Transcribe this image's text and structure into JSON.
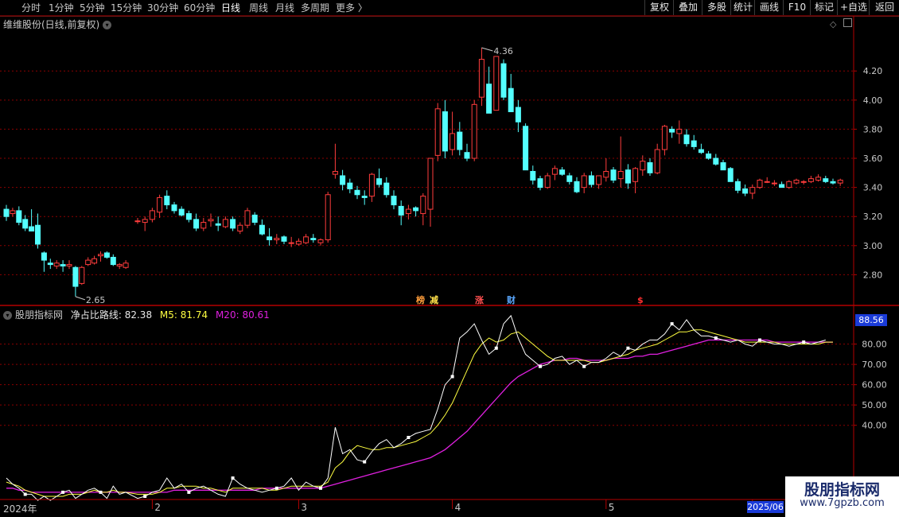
{
  "toolbar": {
    "timeframes": [
      "分时",
      "1分钟",
      "5分钟",
      "15分钟",
      "30分钟",
      "60分钟",
      "日线",
      "周线",
      "月线",
      "多周期",
      "更多"
    ],
    "active": "日线",
    "more_arrow": "〉",
    "right_buttons": [
      "复权",
      "叠加",
      "多股",
      "统计",
      "画线",
      "F10",
      "标记",
      "+自选",
      "返回"
    ]
  },
  "stock": {
    "title": "维维股份(日线,前复权)",
    "high_label": "4.36",
    "low_label": "2.65",
    "y_ticks": [
      "4.20",
      "4.00",
      "3.80",
      "3.60",
      "3.40",
      "3.20",
      "3.00",
      "2.80"
    ],
    "marks": [
      {
        "text": "榜",
        "color": "#ff9d3a"
      },
      {
        "text": "减",
        "color": "#ffe04a"
      },
      {
        "text": "涨",
        "color": "#ff5050"
      },
      {
        "text": "财",
        "color": "#5aa8ff"
      },
      {
        "text": "$",
        "color": "#ff3030"
      }
    ]
  },
  "indicator": {
    "name": "股朋指标网",
    "line_label": "净占比路线:",
    "line_value": "82.38",
    "m5_label": "M5:",
    "m5_value": "81.74",
    "m20_label": "M20:",
    "m20_value": "80.61",
    "current_value": "88.56",
    "y_ticks": [
      "80.00",
      "70.00",
      "60.00",
      "50.00",
      "40.00"
    ],
    "colors": {
      "main": "#ffffff",
      "m5": "#ffff40",
      "m20": "#e020e0"
    }
  },
  "x_axis": {
    "labels": [
      "2024年",
      "2",
      "3",
      "4",
      "5",
      "6"
    ],
    "end_label": "2025/06"
  },
  "watermark": {
    "title": "股朋指标网",
    "url": "www.7gpzb.com"
  },
  "colors": {
    "up": "#ff3c3c",
    "down": "#54ffff",
    "grid": "#8b0000",
    "axis": "#b40000"
  },
  "chart_data": {
    "type": "candlestick",
    "ohlc": [
      [
        3.25,
        3.28,
        3.17,
        3.2
      ],
      [
        3.22,
        3.26,
        3.2,
        3.24
      ],
      [
        3.24,
        3.27,
        3.14,
        3.16
      ],
      [
        3.18,
        3.21,
        3.1,
        3.12
      ],
      [
        3.13,
        3.25,
        3.1,
        3.1
      ],
      [
        3.14,
        3.22,
        2.98,
        3.01
      ],
      [
        2.95,
        2.96,
        2.82,
        2.9
      ],
      [
        2.88,
        2.91,
        2.84,
        2.87
      ],
      [
        2.86,
        2.9,
        2.84,
        2.88
      ],
      [
        2.87,
        2.9,
        2.82,
        2.86
      ],
      [
        2.86,
        2.9,
        2.84,
        2.87
      ],
      [
        2.85,
        2.86,
        2.65,
        2.72
      ],
      [
        2.74,
        2.86,
        2.73,
        2.85
      ],
      [
        2.87,
        2.92,
        2.86,
        2.9
      ],
      [
        2.88,
        2.93,
        2.87,
        2.91
      ],
      [
        2.93,
        2.96,
        2.89,
        2.94
      ],
      [
        2.95,
        2.96,
        2.91,
        2.92
      ],
      [
        2.92,
        2.94,
        2.86,
        2.87
      ],
      [
        2.86,
        2.88,
        2.84,
        2.87
      ],
      [
        2.85,
        2.9,
        2.84,
        2.88
      ],
      [
        3.17,
        3.19,
        3.15,
        3.17
      ],
      [
        3.16,
        3.2,
        3.1,
        3.18
      ],
      [
        3.18,
        3.26,
        3.16,
        3.24
      ],
      [
        3.23,
        3.35,
        3.19,
        3.33
      ],
      [
        3.34,
        3.38,
        3.25,
        3.28
      ],
      [
        3.28,
        3.3,
        3.22,
        3.24
      ],
      [
        3.25,
        3.27,
        3.2,
        3.21
      ],
      [
        3.22,
        3.24,
        3.16,
        3.18
      ],
      [
        3.18,
        3.22,
        3.1,
        3.12
      ],
      [
        3.12,
        3.19,
        3.1,
        3.16
      ],
      [
        3.17,
        3.22,
        3.13,
        3.18
      ],
      [
        3.15,
        3.2,
        3.1,
        3.14
      ],
      [
        3.13,
        3.2,
        3.12,
        3.18
      ],
      [
        3.18,
        3.2,
        3.1,
        3.12
      ],
      [
        3.1,
        3.16,
        3.08,
        3.14
      ],
      [
        3.14,
        3.26,
        3.12,
        3.24
      ],
      [
        3.21,
        3.23,
        3.14,
        3.16
      ],
      [
        3.14,
        3.18,
        3.07,
        3.08
      ],
      [
        3.06,
        3.12,
        3.0,
        3.04
      ],
      [
        3.04,
        3.08,
        3.01,
        3.05
      ],
      [
        3.06,
        3.07,
        3.01,
        3.03
      ],
      [
        3.02,
        3.06,
        2.99,
        3.02
      ],
      [
        3.01,
        3.05,
        3.0,
        3.03
      ],
      [
        3.02,
        3.08,
        3.01,
        3.06
      ],
      [
        3.05,
        3.08,
        3.02,
        3.04
      ],
      [
        3.02,
        3.05,
        3.0,
        3.04
      ],
      [
        3.04,
        3.37,
        3.02,
        3.35
      ],
      [
        3.49,
        3.7,
        3.46,
        3.51
      ],
      [
        3.48,
        3.52,
        3.38,
        3.42
      ],
      [
        3.43,
        3.46,
        3.36,
        3.39
      ],
      [
        3.38,
        3.41,
        3.32,
        3.35
      ],
      [
        3.34,
        3.38,
        3.28,
        3.33
      ],
      [
        3.34,
        3.5,
        3.3,
        3.49
      ],
      [
        3.46,
        3.53,
        3.4,
        3.42
      ],
      [
        3.43,
        3.47,
        3.33,
        3.35
      ],
      [
        3.34,
        3.38,
        3.25,
        3.28
      ],
      [
        3.27,
        3.31,
        3.14,
        3.21
      ],
      [
        3.22,
        3.28,
        3.18,
        3.25
      ],
      [
        3.26,
        3.27,
        3.2,
        3.24
      ],
      [
        3.22,
        3.36,
        3.14,
        3.34
      ],
      [
        3.25,
        3.58,
        3.13,
        3.6
      ],
      [
        3.62,
        3.98,
        3.58,
        3.94
      ],
      [
        3.92,
        4.0,
        3.6,
        3.65
      ],
      [
        3.66,
        3.92,
        3.62,
        3.77
      ],
      [
        3.78,
        3.85,
        3.62,
        3.66
      ],
      [
        3.64,
        3.7,
        3.58,
        3.6
      ],
      [
        3.6,
        4.0,
        3.58,
        3.97
      ],
      [
        4.02,
        4.36,
        3.96,
        4.28
      ],
      [
        4.11,
        4.23,
        3.92,
        3.91
      ],
      [
        3.93,
        4.3,
        3.94,
        4.3
      ],
      [
        4.25,
        4.28,
        4.0,
        4.02
      ],
      [
        4.08,
        4.18,
        3.98,
        3.92
      ],
      [
        3.95,
        4.0,
        3.78,
        3.85
      ],
      [
        3.82,
        3.84,
        3.73,
        3.52
      ],
      [
        3.51,
        3.55,
        3.42,
        3.45
      ],
      [
        3.46,
        3.48,
        3.38,
        3.4
      ],
      [
        3.4,
        3.5,
        3.39,
        3.48
      ],
      [
        3.49,
        3.55,
        3.45,
        3.53
      ],
      [
        3.52,
        3.54,
        3.48,
        3.49
      ],
      [
        3.48,
        3.5,
        3.42,
        3.44
      ],
      [
        3.44,
        3.47,
        3.36,
        3.37
      ],
      [
        3.4,
        3.5,
        3.36,
        3.48
      ],
      [
        3.48,
        3.51,
        3.4,
        3.42
      ],
      [
        3.42,
        3.48,
        3.39,
        3.48
      ],
      [
        3.47,
        3.6,
        3.44,
        3.51
      ],
      [
        3.52,
        3.54,
        3.43,
        3.45
      ],
      [
        3.46,
        3.75,
        3.4,
        3.51
      ],
      [
        3.52,
        3.56,
        3.39,
        3.43
      ],
      [
        3.44,
        3.54,
        3.36,
        3.53
      ],
      [
        3.52,
        3.62,
        3.48,
        3.58
      ],
      [
        3.57,
        3.6,
        3.48,
        3.5
      ],
      [
        3.5,
        3.7,
        3.49,
        3.66
      ],
      [
        3.66,
        3.83,
        3.62,
        3.82
      ],
      [
        3.8,
        3.82,
        3.74,
        3.78
      ],
      [
        3.77,
        3.86,
        3.7,
        3.8
      ],
      [
        3.76,
        3.8,
        3.68,
        3.7
      ],
      [
        3.72,
        3.76,
        3.66,
        3.68
      ],
      [
        3.66,
        3.7,
        3.63,
        3.64
      ],
      [
        3.63,
        3.65,
        3.59,
        3.6
      ],
      [
        3.6,
        3.63,
        3.55,
        3.56
      ],
      [
        3.57,
        3.59,
        3.52,
        3.52
      ],
      [
        3.53,
        3.54,
        3.44,
        3.44
      ],
      [
        3.44,
        3.46,
        3.36,
        3.38
      ],
      [
        3.39,
        3.42,
        3.34,
        3.36
      ],
      [
        3.36,
        3.42,
        3.32,
        3.4
      ],
      [
        3.4,
        3.46,
        3.39,
        3.45
      ],
      [
        3.44,
        3.47,
        3.43,
        3.44
      ],
      [
        3.43,
        3.45,
        3.41,
        3.43
      ],
      [
        3.42,
        3.44,
        3.4,
        3.4
      ],
      [
        3.4,
        3.45,
        3.39,
        3.44
      ],
      [
        3.43,
        3.46,
        3.42,
        3.45
      ],
      [
        3.44,
        3.45,
        3.42,
        3.44
      ],
      [
        3.44,
        3.48,
        3.43,
        3.46
      ],
      [
        3.45,
        3.49,
        3.44,
        3.47
      ],
      [
        3.46,
        3.48,
        3.43,
        3.44
      ],
      [
        3.44,
        3.46,
        3.42,
        3.43
      ],
      [
        3.43,
        3.46,
        3.41,
        3.45
      ]
    ],
    "price_ylim": [
      2.6,
      4.48
    ],
    "indicator_line": [
      14,
      11,
      9,
      6,
      6,
      3,
      5,
      3,
      5,
      7,
      8,
      4,
      6,
      8,
      9,
      7,
      4,
      10,
      6,
      7,
      4,
      5,
      7,
      8,
      14,
      9,
      11,
      7,
      9,
      10,
      8,
      6,
      5,
      14,
      11,
      9,
      8,
      7,
      8,
      9,
      10,
      14,
      8,
      12,
      10,
      9,
      14,
      39,
      26,
      28,
      23,
      22,
      27,
      31,
      33,
      29,
      31,
      34,
      36,
      37,
      38,
      48,
      60,
      64,
      83,
      86,
      90,
      82,
      75,
      78,
      90,
      94,
      83,
      75,
      72,
      69,
      70,
      73,
      74,
      70,
      72,
      69,
      71,
      71,
      73,
      76,
      74,
      78,
      77,
      80,
      82,
      82,
      85,
      90,
      87,
      92,
      87,
      84,
      84,
      83,
      82,
      81,
      82,
      80,
      79,
      82,
      81,
      80,
      80,
      79,
      80,
      81,
      80,
      81,
      82
    ],
    "m5": [
      12,
      11,
      10,
      8,
      7,
      6,
      5,
      5,
      5,
      5,
      6,
      6,
      6,
      7,
      8,
      7,
      7,
      8,
      7,
      7,
      6,
      6,
      6,
      7,
      9,
      9,
      10,
      10,
      10,
      9,
      9,
      8,
      7,
      9,
      9,
      9,
      9,
      9,
      8,
      8,
      9,
      10,
      10,
      10,
      10,
      10,
      12,
      19,
      22,
      27,
      30,
      29,
      28,
      28,
      29,
      29,
      30,
      31,
      32,
      34,
      36,
      40,
      45,
      51,
      59,
      67,
      75,
      80,
      83,
      81,
      82,
      85,
      86,
      83,
      80,
      77,
      74,
      72,
      72,
      72,
      72,
      72,
      71,
      71,
      72,
      73,
      74,
      75,
      77,
      78,
      79,
      80,
      82,
      84,
      86,
      86,
      87,
      87,
      86,
      85,
      84,
      83,
      82,
      81,
      81,
      81,
      81,
      81,
      80,
      80,
      80,
      80,
      80,
      80,
      81,
      81
    ],
    "m20": [
      9,
      9,
      8,
      8,
      7,
      7,
      7,
      7,
      7,
      7,
      7,
      7,
      7,
      7,
      7,
      7,
      7,
      7,
      7,
      7,
      7,
      7,
      7,
      7,
      7,
      8,
      8,
      8,
      8,
      8,
      8,
      8,
      8,
      8,
      8,
      8,
      8,
      9,
      9,
      9,
      9,
      9,
      9,
      9,
      9,
      9,
      10,
      11,
      12,
      13,
      14,
      15,
      16,
      17,
      18,
      19,
      20,
      21,
      22,
      23,
      24,
      26,
      28,
      31,
      34,
      37,
      41,
      45,
      49,
      53,
      57,
      61,
      64,
      66,
      68,
      70,
      71,
      72,
      72,
      73,
      73,
      72,
      72,
      72,
      72,
      73,
      73,
      73,
      74,
      74,
      75,
      75,
      76,
      77,
      78,
      79,
      80,
      81,
      82,
      82,
      82,
      82,
      82,
      82,
      82,
      82,
      82,
      81,
      81,
      81,
      81,
      81,
      81,
      81,
      81,
      81
    ],
    "indicator_ylim": [
      5,
      92
    ]
  }
}
